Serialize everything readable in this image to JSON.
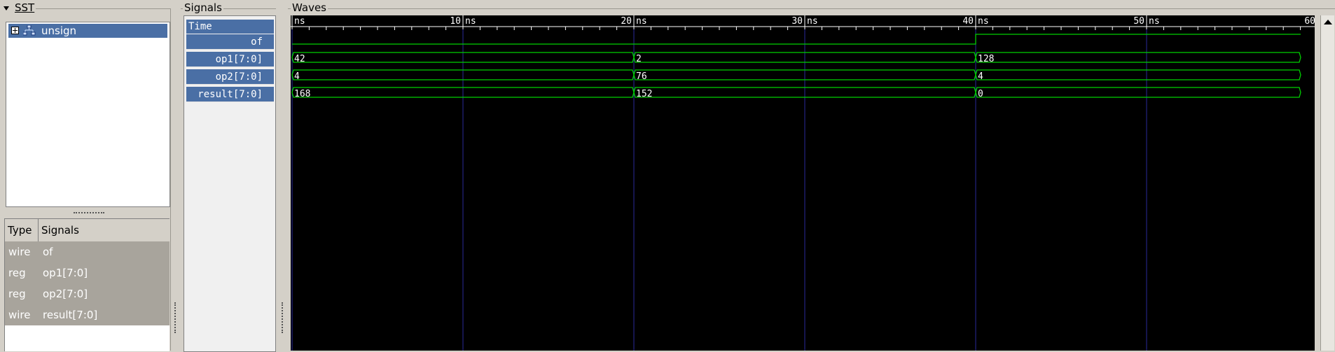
{
  "sst": {
    "label": "SST",
    "tree": [
      {
        "label": "unsign",
        "expander": "+",
        "icon": "module-hierarchy-icon"
      }
    ]
  },
  "signal_table": {
    "headers": [
      "Type",
      "Signals"
    ],
    "rows": [
      {
        "type": "wire",
        "name": "of"
      },
      {
        "type": "reg",
        "name": "op1[7:0]"
      },
      {
        "type": "reg",
        "name": "op2[7:0]"
      },
      {
        "type": "wire",
        "name": "result[7:0]"
      }
    ]
  },
  "signals": {
    "label": "Signals",
    "time_header": "Time",
    "names": [
      "of",
      "op1[7:0]",
      "op2[7:0]",
      "result[7:0]"
    ]
  },
  "waves": {
    "label": "Waves",
    "unit": "ns",
    "major_ticks": [
      0,
      10,
      20,
      30,
      40,
      50,
      60
    ],
    "time_range": [
      0,
      60
    ],
    "colors": {
      "background": "#000000",
      "trace": "#00d000",
      "grid": "#2a2a9a",
      "text": "#ffffff"
    },
    "traces": [
      {
        "name": "of",
        "kind": "bit",
        "transitions": [
          [
            0,
            0
          ],
          [
            40,
            1
          ]
        ]
      },
      {
        "name": "op1[7:0]",
        "kind": "bus",
        "segments": [
          {
            "start": 0,
            "value": "42"
          },
          {
            "start": 20,
            "value": "2"
          },
          {
            "start": 40,
            "value": "128"
          }
        ]
      },
      {
        "name": "op2[7:0]",
        "kind": "bus",
        "segments": [
          {
            "start": 0,
            "value": "4"
          },
          {
            "start": 20,
            "value": "76"
          },
          {
            "start": 40,
            "value": "4"
          }
        ]
      },
      {
        "name": "result[7:0]",
        "kind": "bus",
        "segments": [
          {
            "start": 0,
            "value": "168"
          },
          {
            "start": 20,
            "value": "152"
          },
          {
            "start": 40,
            "value": "0"
          }
        ]
      }
    ]
  }
}
